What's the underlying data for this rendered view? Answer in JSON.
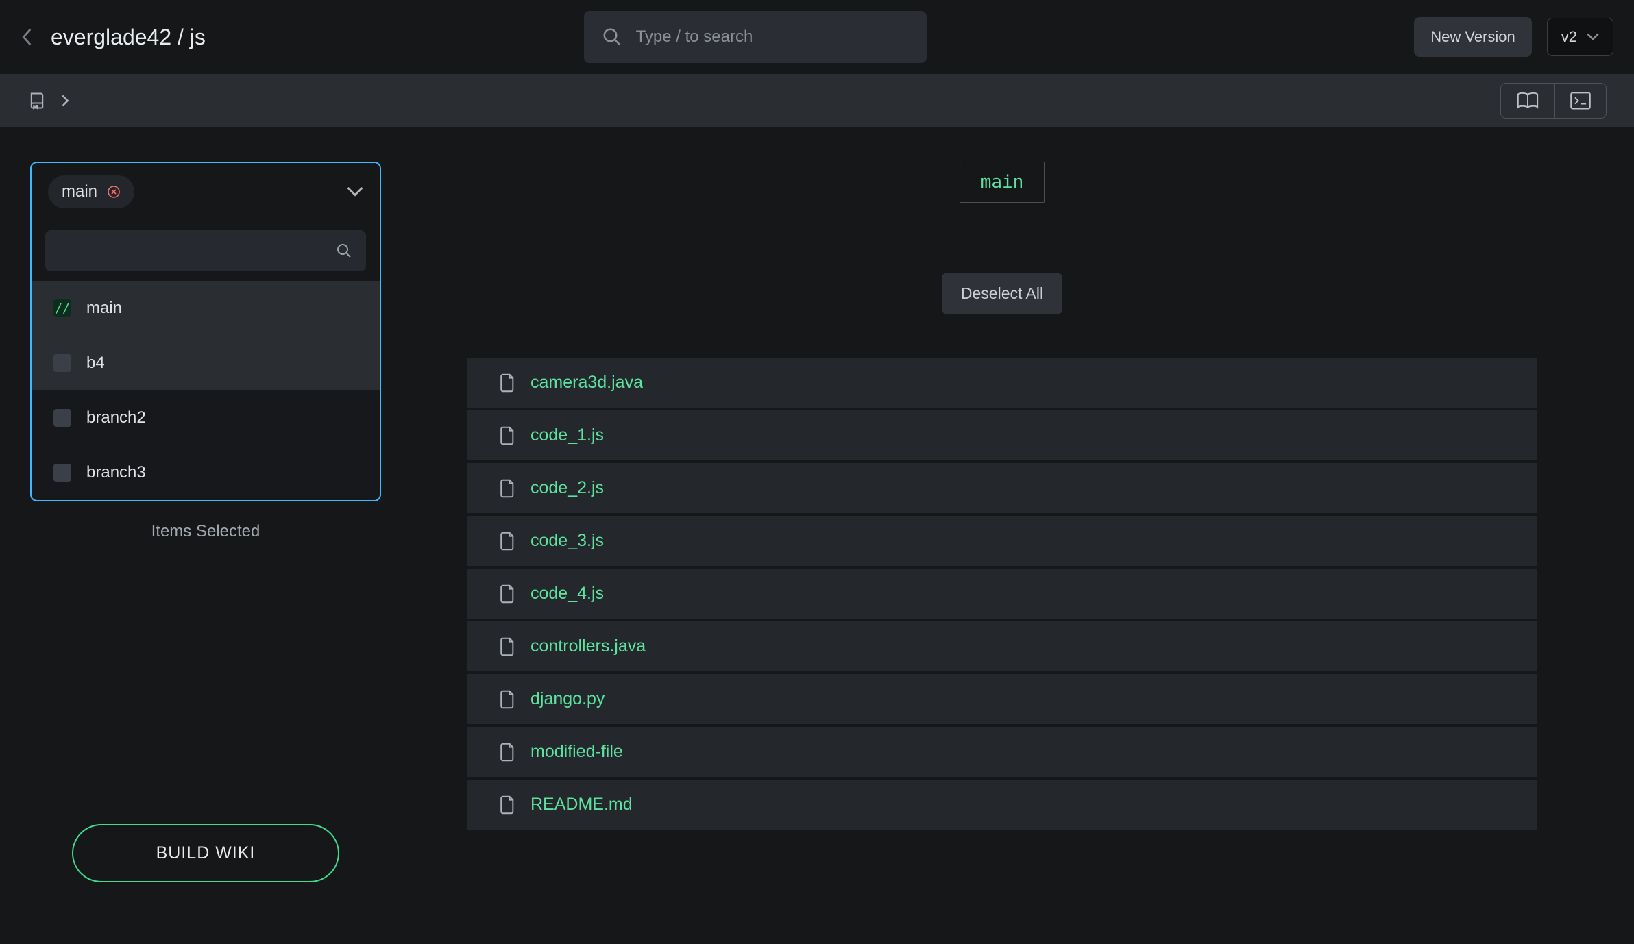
{
  "header": {
    "breadcrumb": "everglade42 / js",
    "search_placeholder": "Type / to search",
    "new_version_label": "New Version",
    "version_label": "v2"
  },
  "sidebar": {
    "selected_chip": "main",
    "branches": [
      {
        "label": "main",
        "checked": true,
        "highlight": true
      },
      {
        "label": "b4",
        "checked": false,
        "highlight": true
      },
      {
        "label": "branch2",
        "checked": false,
        "highlight": false
      },
      {
        "label": "branch3",
        "checked": false,
        "highlight": false
      }
    ],
    "items_selected_label": "Items Selected",
    "build_wiki_label": "BUILD WIKI"
  },
  "content": {
    "branch_badge": "main",
    "deselect_label": "Deselect All",
    "files": [
      "camera3d.java",
      "code_1.js",
      "code_2.js",
      "code_3.js",
      "code_4.js",
      "controllers.java",
      "django.py",
      "modified-file",
      "README.md"
    ]
  }
}
